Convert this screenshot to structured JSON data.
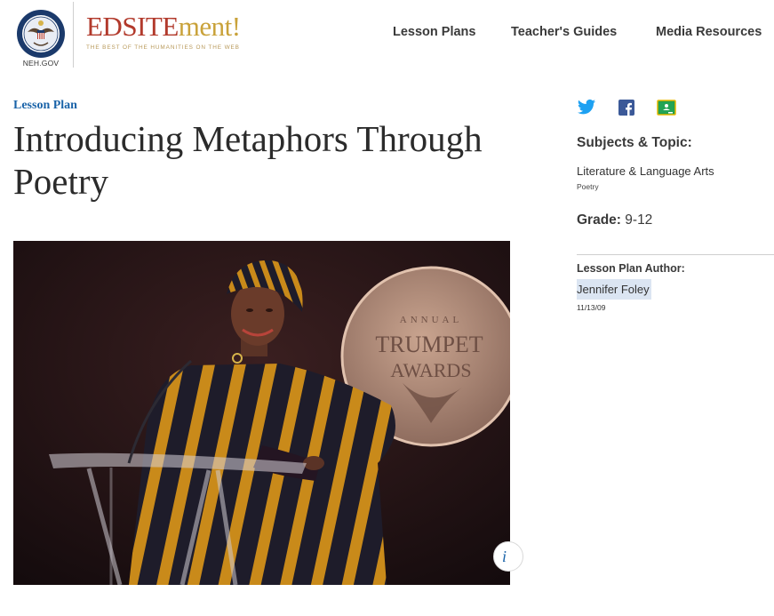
{
  "header": {
    "seal_alt": "NEH seal",
    "neh_gov": "NEH.GOV",
    "brand_main": "EDSITE",
    "brand_accent": "ment!",
    "tagline": "THE BEST OF THE HUMANITIES ON THE WEB",
    "nav": [
      "Lesson Plans",
      "Teacher's Guides",
      "Media Resources"
    ]
  },
  "main": {
    "eyebrow": "Lesson Plan",
    "title": "Introducing Metaphors Through Poetry",
    "photo_alt": "Woman in a striped robe and headwrap smiling at a podium in front of an Annual Trumpet Awards sign",
    "photo_sign_line1": "ANNUAL",
    "photo_sign_line2": "TRUMPET",
    "photo_sign_line3": "AWARDS",
    "info_glyph": "i"
  },
  "sidebar": {
    "share_icons": [
      "twitter-icon",
      "facebook-icon",
      "google-classroom-icon"
    ],
    "subjects_heading": "Subjects & Topic:",
    "subject": "Literature & Language Arts",
    "topic": "Poetry",
    "grade_label": "Grade:",
    "grade_value": "9-12",
    "author_heading": "Lesson Plan Author:",
    "author": "Jennifer Foley",
    "date": "11/13/09"
  },
  "colors": {
    "brand_red": "#b23a2c",
    "brand_gold": "#c9a23a",
    "link_blue": "#1a63a8",
    "twitter": "#1da1f2",
    "facebook": "#3b5998",
    "classroom": "#1e9e4a",
    "highlight": "#dbe5f2"
  }
}
